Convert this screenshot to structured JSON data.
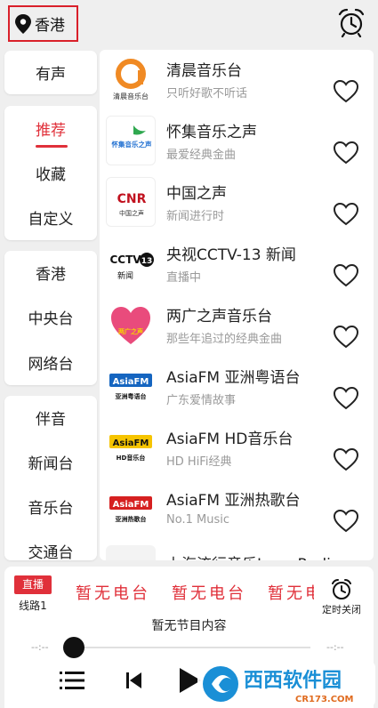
{
  "location": {
    "label": "香港"
  },
  "categories": {
    "group1": [
      "有声"
    ],
    "group2": [
      "推荐",
      "收藏",
      "自定义"
    ],
    "group3": [
      "香港",
      "中央台",
      "网络台"
    ],
    "group4": [
      "伴音",
      "新闻台",
      "音乐台",
      "交通台"
    ],
    "active": "推荐"
  },
  "stations": [
    {
      "name": "清晨音乐台",
      "desc": "只听好歌不听话",
      "logo_text": "清晨音乐台",
      "logo": "qingchen-logo"
    },
    {
      "name": "怀集音乐之声",
      "desc": "最爱经典金曲",
      "logo_text": "怀集音乐之声",
      "logo": "huaiji-logo"
    },
    {
      "name": "中国之声",
      "desc": "新闻进行时",
      "logo_text": "CNR",
      "logo_sub": "中国之声",
      "logo": "cnr-logo"
    },
    {
      "name": "央视CCTV-13 新闻",
      "desc": "直播中",
      "logo_text": "CCTV",
      "logo_num": "13",
      "logo_sub": "新闻",
      "logo": "cctv13-logo"
    },
    {
      "name": "两广之声音乐台",
      "desc": "那些年追过的经典金曲",
      "logo_text": "两广之声",
      "logo": "lianguang-logo"
    },
    {
      "name": "AsiaFM 亚洲粤语台",
      "desc": "广东爱情故事",
      "logo_text": "AsiaFM",
      "logo_sub": "亚洲粤语台",
      "logo": "asiafm-yue-logo"
    },
    {
      "name": "AsiaFM HD音乐台",
      "desc": "HD HiFi经典",
      "logo_text": "AsiaFM",
      "logo_sub": "HD音乐台",
      "logo": "asiafm-hd-logo"
    },
    {
      "name": "AsiaFM 亚洲热歌台",
      "desc": "No.1 Music",
      "logo_text": "AsiaFM",
      "logo_sub": "亚洲热歌台",
      "logo": "asiafm-hot-logo"
    },
    {
      "name": "上海流行音乐Love Radio",
      "desc": "",
      "logo": "partial"
    }
  ],
  "player": {
    "live_label": "直播",
    "line_label": "线路1",
    "marquee": [
      "暂无电台",
      "暂无电台",
      "暂无电台"
    ],
    "program": "暂无节目内容",
    "time_left": "--:--",
    "time_right": "--:--",
    "timer_label": "定时关闭",
    "progress": 0
  },
  "watermark": {
    "text": "西西软件园",
    "sub": "CR173.COM"
  },
  "colors": {
    "accent": "#e0303a",
    "background": "#efefef"
  }
}
